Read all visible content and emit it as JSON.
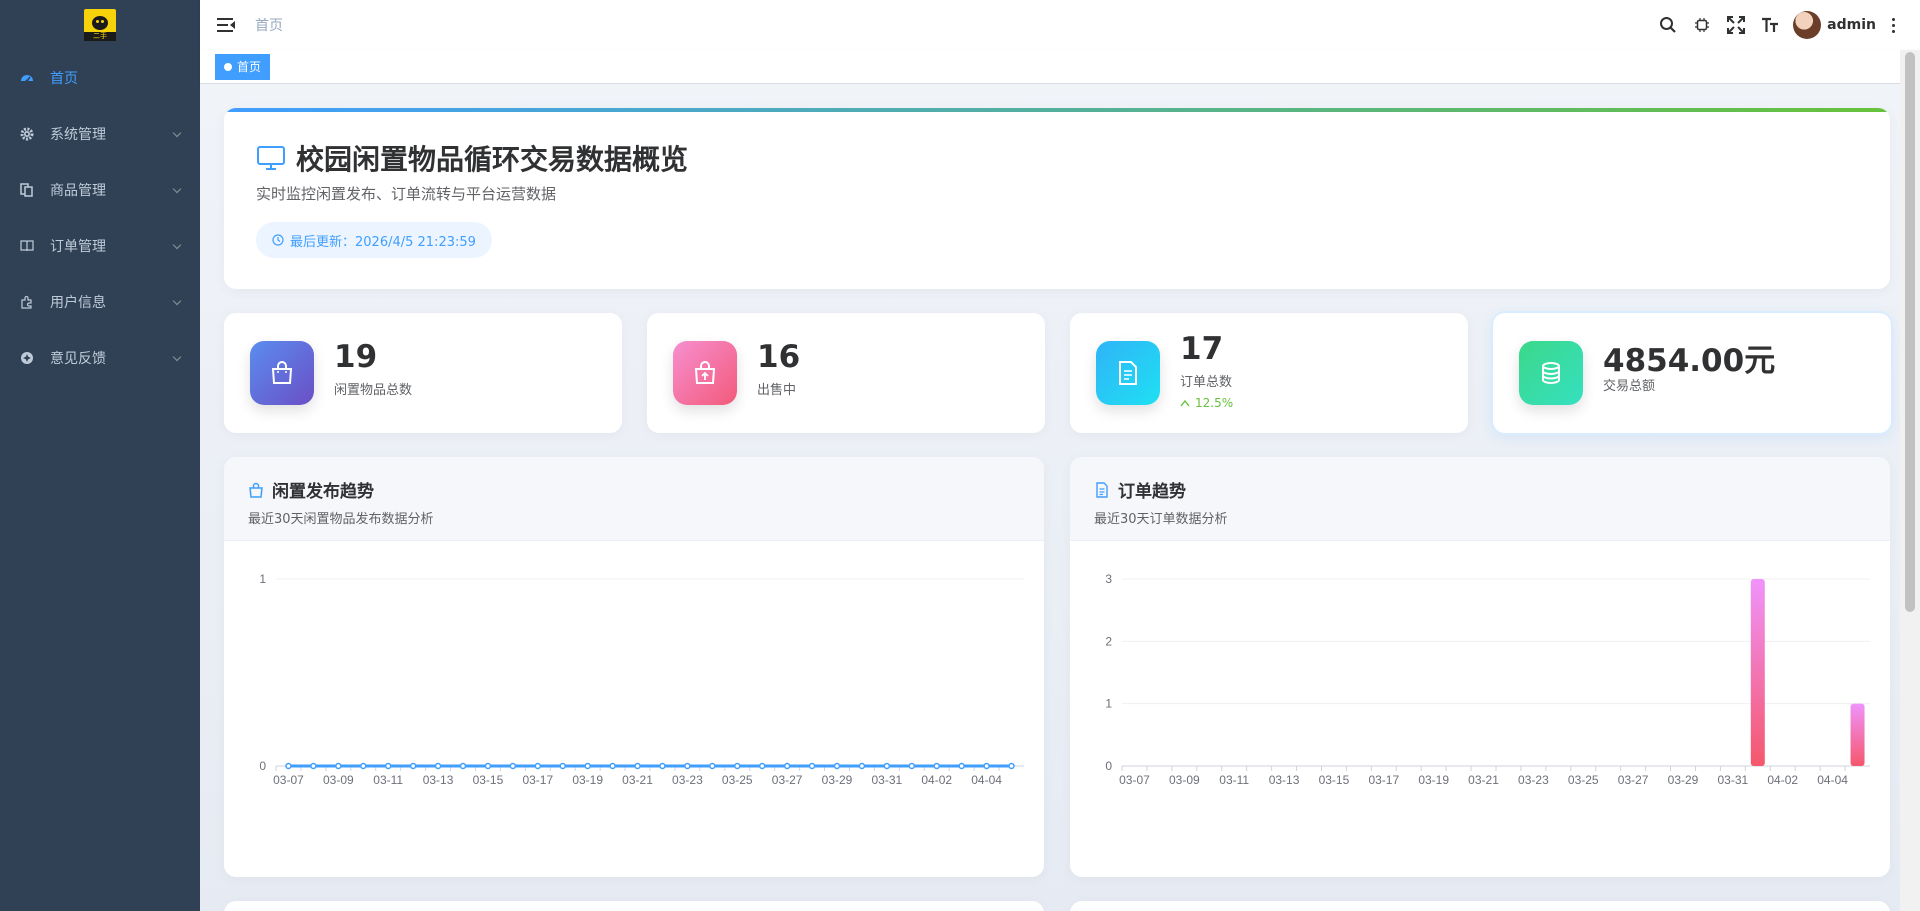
{
  "logo": {
    "text": "二手"
  },
  "sidebar": {
    "items": [
      {
        "label": "首页",
        "icon": "dashboard-icon",
        "active": true
      },
      {
        "label": "系统管理",
        "icon": "gear-icon"
      },
      {
        "label": "商品管理",
        "icon": "documents-icon"
      },
      {
        "label": "订单管理",
        "icon": "book-icon"
      },
      {
        "label": "用户信息",
        "icon": "puzzle-icon"
      },
      {
        "label": "意见反馈",
        "icon": "feedback-icon"
      }
    ]
  },
  "navbar": {
    "breadcrumb": "首页",
    "user": "admin"
  },
  "tags": {
    "active": "首页"
  },
  "hero": {
    "title": "校园闲置物品循环交易数据概览",
    "subtitle": "实时监控闲置发布、订单流转与平台运营数据",
    "updated": "最后更新：2026/4/5 21:23:59"
  },
  "stats": [
    {
      "value": "19",
      "label": "闲置物品总数",
      "icon": "bag-icon",
      "colors": [
        "#5b8def",
        "#6a4fc6"
      ]
    },
    {
      "value": "16",
      "label": "出售中",
      "icon": "bag-upload-icon",
      "colors": [
        "#f78fd0",
        "#f25a7a"
      ]
    },
    {
      "value": "17",
      "label": "订单总数",
      "trend": "12.5%",
      "icon": "document-icon",
      "colors": [
        "#2fb4f8",
        "#1fe0f2"
      ]
    },
    {
      "value": "4854.00元",
      "label": "交易总额",
      "icon": "coins-icon",
      "colors": [
        "#3bd88a",
        "#35e0c0"
      ]
    }
  ],
  "charts": {
    "publish": {
      "title": "闲置发布趋势",
      "subtitle": "最近30天闲置物品发布数据分析"
    },
    "orders": {
      "title": "订单趋势",
      "subtitle": "最近30天订单数据分析"
    }
  },
  "chart_data": [
    {
      "type": "line",
      "x": [
        "03-07",
        "03-08",
        "03-09",
        "03-10",
        "03-11",
        "03-12",
        "03-13",
        "03-14",
        "03-15",
        "03-16",
        "03-17",
        "03-18",
        "03-19",
        "03-20",
        "03-21",
        "03-22",
        "03-23",
        "03-24",
        "03-25",
        "03-26",
        "03-27",
        "03-28",
        "03-29",
        "03-30",
        "03-31",
        "04-01",
        "04-02",
        "04-03",
        "04-04",
        "04-05"
      ],
      "xticks": [
        "03-07",
        "03-09",
        "03-11",
        "03-13",
        "03-15",
        "03-17",
        "03-19",
        "03-21",
        "03-23",
        "03-25",
        "03-27",
        "03-29",
        "03-31",
        "04-02",
        "04-04"
      ],
      "values": [
        0,
        0,
        0,
        0,
        0,
        0,
        0,
        0,
        0,
        0,
        0,
        0,
        0,
        0,
        0,
        0,
        0,
        0,
        0,
        0,
        0,
        0,
        0,
        0,
        0,
        0,
        0,
        0,
        0,
        0
      ],
      "ylim": [
        0,
        1
      ],
      "yticks": [
        0,
        1
      ],
      "color": "#409eff"
    },
    {
      "type": "bar",
      "x": [
        "03-07",
        "03-08",
        "03-09",
        "03-10",
        "03-11",
        "03-12",
        "03-13",
        "03-14",
        "03-15",
        "03-16",
        "03-17",
        "03-18",
        "03-19",
        "03-20",
        "03-21",
        "03-22",
        "03-23",
        "03-24",
        "03-25",
        "03-26",
        "03-27",
        "03-28",
        "03-29",
        "03-30",
        "03-31",
        "04-01",
        "04-02",
        "04-03",
        "04-04",
        "04-05"
      ],
      "xticks": [
        "03-07",
        "03-09",
        "03-11",
        "03-13",
        "03-15",
        "03-17",
        "03-19",
        "03-21",
        "03-23",
        "03-25",
        "03-27",
        "03-29",
        "03-31",
        "04-02",
        "04-04"
      ],
      "values": [
        0,
        0,
        0,
        0,
        0,
        0,
        0,
        0,
        0,
        0,
        0,
        0,
        0,
        0,
        0,
        0,
        0,
        0,
        0,
        0,
        0,
        0,
        0,
        0,
        0,
        3,
        0,
        0,
        0,
        1
      ],
      "ylim": [
        0,
        3
      ],
      "yticks": [
        0,
        1,
        2,
        3
      ],
      "colors": [
        "#f093fb",
        "#f5576c"
      ]
    }
  ]
}
